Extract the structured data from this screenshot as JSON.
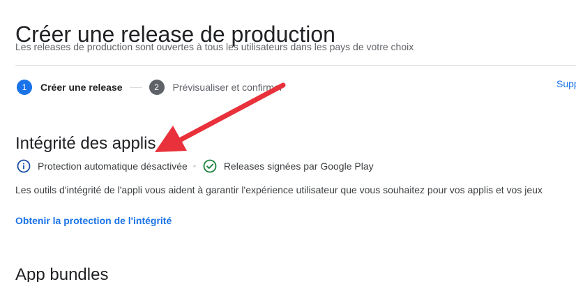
{
  "header": {
    "title": "Créer une release de production",
    "subtitle": "Les releases de production sont ouvertes à tous les utilisateurs dans les pays de votre choix"
  },
  "stepper": {
    "steps": [
      {
        "number": "1",
        "label": "Créer une release",
        "state": "active"
      },
      {
        "number": "2",
        "label": "Prévisualiser et confirmer",
        "state": "inactive"
      }
    ],
    "support_link": "Supp"
  },
  "integrity": {
    "title": "Intégrité des applis",
    "statuses": [
      {
        "icon": "info-icon",
        "text": "Protection automatique désactivée"
      },
      {
        "icon": "check-circle-icon",
        "text": "Releases signées par Google Play"
      }
    ],
    "description": "Les outils d'intégrité de l'appli vous aident à garantir l'expérience utilisateur que vous souhaitez pour vos applis et vos jeux",
    "link": "Obtenir la protection de l'intégrité"
  },
  "bundles": {
    "title": "App bundles"
  },
  "colors": {
    "accent": "#1a73e8",
    "success": "#188038",
    "info": "#174ea6",
    "annotation": "#e8313a"
  }
}
